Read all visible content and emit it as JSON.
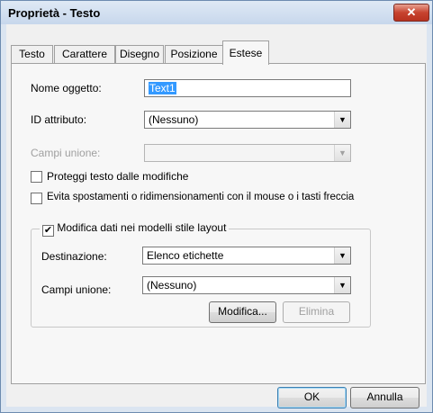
{
  "window": {
    "title": "Proprietà - Testo",
    "close_glyph": "✕"
  },
  "tabs": [
    {
      "label": "Testo",
      "selected": false
    },
    {
      "label": "Carattere",
      "selected": false
    },
    {
      "label": "Disegno",
      "selected": false
    },
    {
      "label": "Posizione",
      "selected": false
    },
    {
      "label": "Estese",
      "selected": true
    }
  ],
  "form": {
    "object_name_label": "Nome oggetto:",
    "object_name_value": "Text1",
    "attribute_id_label": "ID attributo:",
    "attribute_id_value": "(Nessuno)",
    "merge_fields_label": "Campi unione:",
    "merge_fields_value": "",
    "protect_text_label": "Proteggi testo dalle modifiche",
    "protect_text_checked": false,
    "avoid_move_label": "Evita spostamenti o ridimensionamenti con il mouse o i tasti freccia",
    "avoid_move_checked": false
  },
  "layout_group": {
    "legend": "Modifica dati nei modelli stile layout",
    "checked": true,
    "check_glyph": "✔",
    "destination_label": "Destinazione:",
    "destination_value": "Elenco etichette",
    "merge_fields_label": "Campi unione:",
    "merge_fields_value": "(Nessuno)",
    "edit_button": "Modifica...",
    "delete_button": "Elimina"
  },
  "footer": {
    "ok_button": "OK",
    "cancel_button": "Annulla"
  },
  "icons": {
    "dropdown_arrow": "▼"
  },
  "colors": {
    "selection": "#3399ff",
    "close_button": "#c7432f"
  }
}
